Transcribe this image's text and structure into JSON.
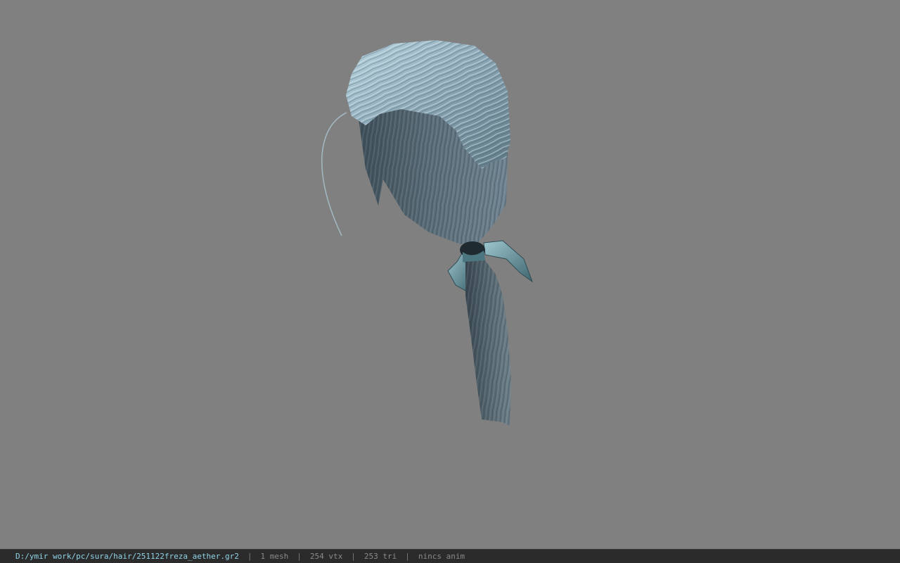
{
  "viewport": {
    "background_color": "#808080",
    "model_name": "hair mesh"
  },
  "statusbar": {
    "file_path": "D:/ymir work/pc/sura/hair/251122freza_aether.gr2",
    "separator": "|",
    "mesh_count": "1 mesh",
    "vertex_count": "254 vtx",
    "triangle_count": "253 tri",
    "anim_status": "nincs anim",
    "path_color": "#8fd4e8",
    "info_color": "#8a8a8a"
  }
}
